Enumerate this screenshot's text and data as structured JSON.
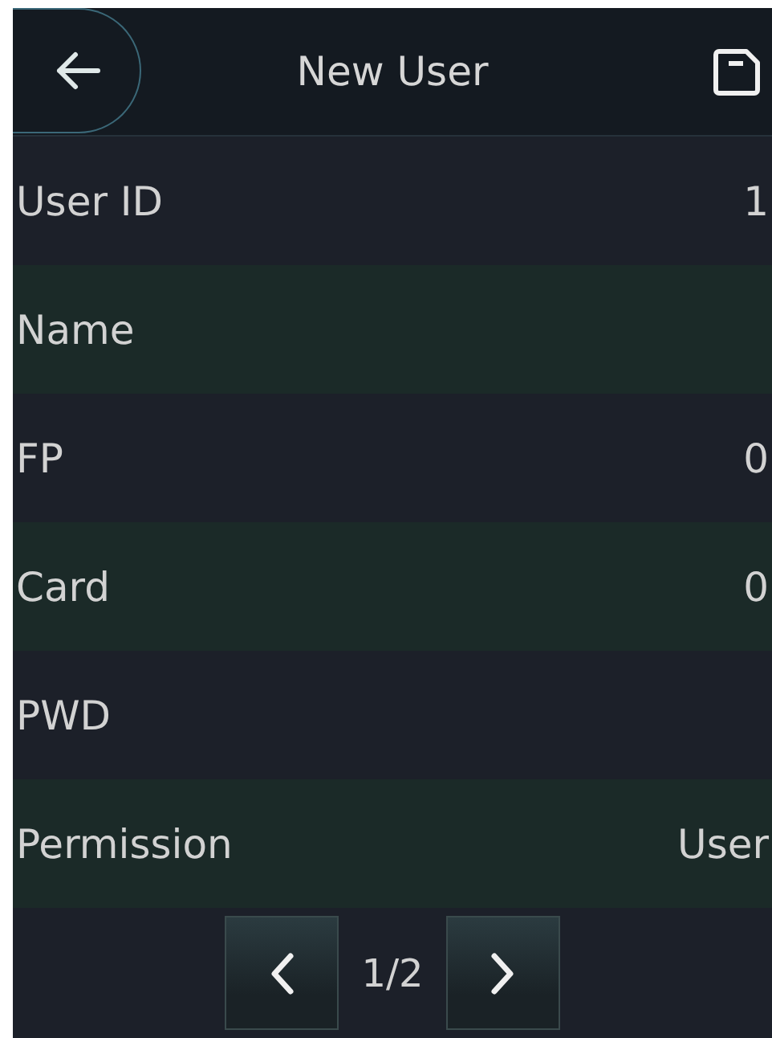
{
  "header": {
    "title": "New User"
  },
  "rows": [
    {
      "label": "User ID",
      "value": "1"
    },
    {
      "label": "Name"
    },
    {
      "label": "FP",
      "value": "0"
    },
    {
      "label": "Card",
      "value": "0"
    },
    {
      "label": "PWD"
    },
    {
      "label": "Permission",
      "value": "User"
    }
  ],
  "pager": {
    "page": "1/2"
  }
}
